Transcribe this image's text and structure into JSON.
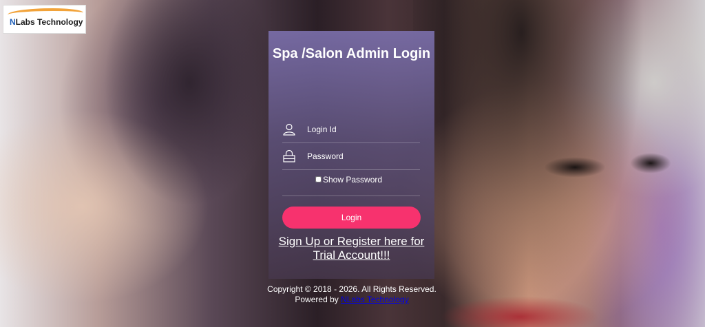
{
  "brand": {
    "logo_text_n": "N",
    "logo_text_rest": "Labs Technology"
  },
  "login": {
    "title": "Spa /Salon Admin Login",
    "login_id_placeholder": "Login Id",
    "password_placeholder": "Password",
    "show_password_label": "Show Password",
    "login_button": "Login",
    "signup_link": "Sign Up or Register here for Trial Account!!!"
  },
  "footer": {
    "copyright": "Copyright © 2018 - 2026. All Rights Reserved. Powered by",
    "company_link": "NLabs Technology"
  },
  "colors": {
    "accent_button": "#f7326e",
    "panel": "#7a6eaa",
    "link": "#0000ee"
  },
  "icons": {
    "user": "user-icon",
    "password": "lock-icon"
  }
}
